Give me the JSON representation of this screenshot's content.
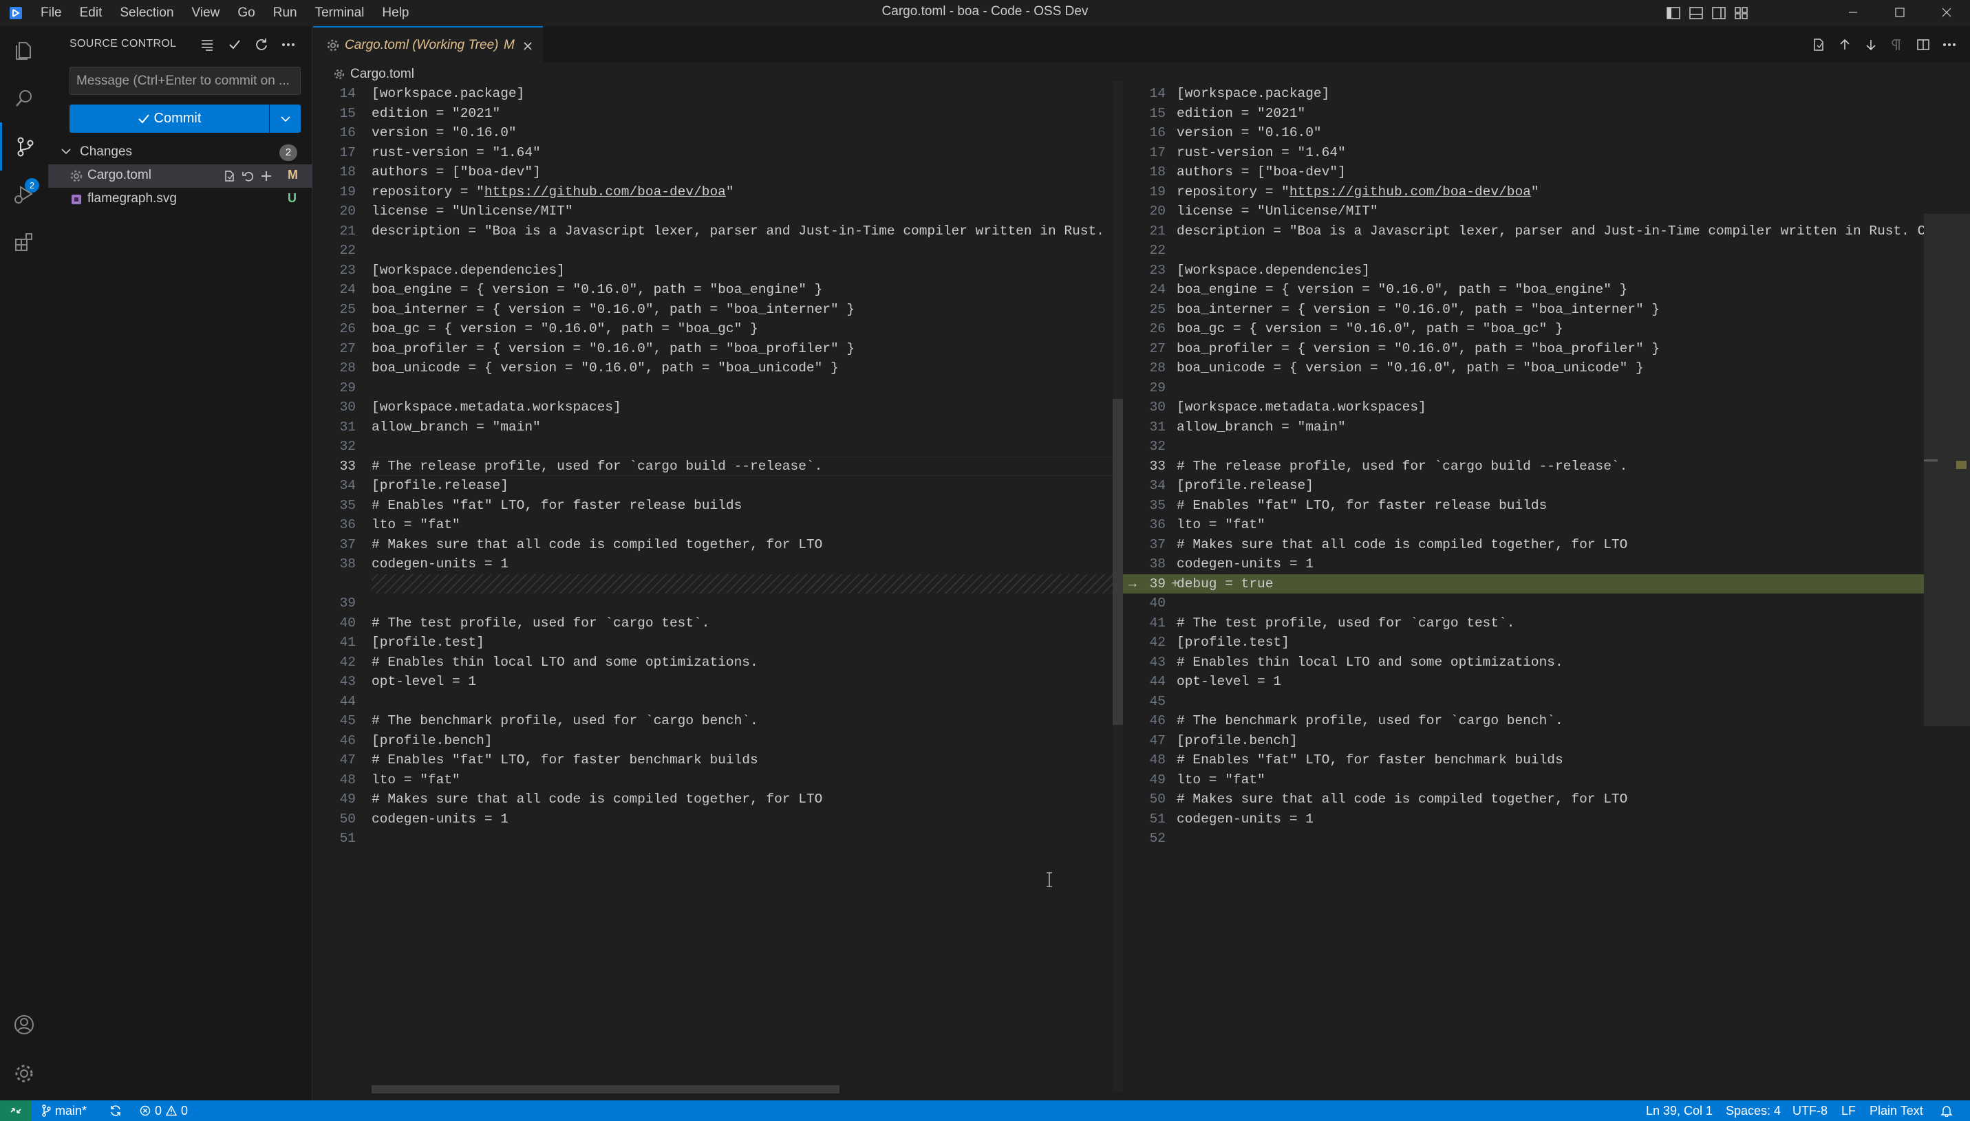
{
  "window": {
    "title": "Cargo.toml - boa - Code - OSS Dev"
  },
  "menu": [
    "File",
    "Edit",
    "Selection",
    "View",
    "Go",
    "Run",
    "Terminal",
    "Help"
  ],
  "activity_bar": {
    "scm_badge": "2"
  },
  "source_control": {
    "title": "SOURCE CONTROL",
    "commit_placeholder": "Message (Ctrl+Enter to commit on ...",
    "commit_label": "Commit",
    "changes_label": "Changes",
    "changes_count": "2",
    "files": [
      {
        "name": "Cargo.toml",
        "status": "M",
        "status_color": "#e2c08d"
      },
      {
        "name": "flamegraph.svg",
        "status": "U",
        "status_color": "#73c991"
      }
    ]
  },
  "tab": {
    "title": "Cargo.toml (Working Tree)",
    "modified": "M"
  },
  "breadcrumb": {
    "file": "Cargo.toml"
  },
  "diff": {
    "left": [
      {
        "n": "14",
        "t": "[workspace.package]"
      },
      {
        "n": "15",
        "t": "edition = \"2021\""
      },
      {
        "n": "16",
        "t": "version = \"0.16.0\""
      },
      {
        "n": "17",
        "t": "rust-version = \"1.64\""
      },
      {
        "n": "18",
        "t": "authors = [\"boa-dev\"]"
      },
      {
        "n": "19",
        "t": "repository = \"https://github.com/boa-dev/boa\""
      },
      {
        "n": "20",
        "t": "license = \"Unlicense/MIT\""
      },
      {
        "n": "21",
        "t": "description = \"Boa is a Javascript lexer, parser and Just-in-Time compiler written in Rust. Cur"
      },
      {
        "n": "22",
        "t": ""
      },
      {
        "n": "23",
        "t": "[workspace.dependencies]"
      },
      {
        "n": "24",
        "t": "boa_engine = { version = \"0.16.0\", path = \"boa_engine\" }"
      },
      {
        "n": "25",
        "t": "boa_interner = { version = \"0.16.0\", path = \"boa_interner\" }"
      },
      {
        "n": "26",
        "t": "boa_gc = { version = \"0.16.0\", path = \"boa_gc\" }"
      },
      {
        "n": "27",
        "t": "boa_profiler = { version = \"0.16.0\", path = \"boa_profiler\" }"
      },
      {
        "n": "28",
        "t": "boa_unicode = { version = \"0.16.0\", path = \"boa_unicode\" }"
      },
      {
        "n": "29",
        "t": ""
      },
      {
        "n": "30",
        "t": "[workspace.metadata.workspaces]"
      },
      {
        "n": "31",
        "t": "allow_branch = \"main\""
      },
      {
        "n": "32",
        "t": ""
      },
      {
        "n": "33",
        "t": "# The release profile, used for `cargo build --release`."
      },
      {
        "n": "34",
        "t": "[profile.release]"
      },
      {
        "n": "35",
        "t": "# Enables \"fat\" LTO, for faster release builds"
      },
      {
        "n": "36",
        "t": "lto = \"fat\""
      },
      {
        "n": "37",
        "t": "# Makes sure that all code is compiled together, for LTO"
      },
      {
        "n": "38",
        "t": "codegen-units = 1"
      },
      {
        "n": "",
        "t": ""
      },
      {
        "n": "39",
        "t": ""
      },
      {
        "n": "40",
        "t": "# The test profile, used for `cargo test`."
      },
      {
        "n": "41",
        "t": "[profile.test]"
      },
      {
        "n": "42",
        "t": "# Enables thin local LTO and some optimizations."
      },
      {
        "n": "43",
        "t": "opt-level = 1"
      },
      {
        "n": "44",
        "t": ""
      },
      {
        "n": "45",
        "t": "# The benchmark profile, used for `cargo bench`."
      },
      {
        "n": "46",
        "t": "[profile.bench]"
      },
      {
        "n": "47",
        "t": "# Enables \"fat\" LTO, for faster benchmark builds"
      },
      {
        "n": "48",
        "t": "lto = \"fat\""
      },
      {
        "n": "49",
        "t": "# Makes sure that all code is compiled together, for LTO"
      },
      {
        "n": "50",
        "t": "codegen-units = 1"
      },
      {
        "n": "51",
        "t": ""
      }
    ],
    "right": [
      {
        "n": "14",
        "t": "[workspace.package]"
      },
      {
        "n": "15",
        "t": "edition = \"2021\""
      },
      {
        "n": "16",
        "t": "version = \"0.16.0\""
      },
      {
        "n": "17",
        "t": "rust-version = \"1.64\""
      },
      {
        "n": "18",
        "t": "authors = [\"boa-dev\"]"
      },
      {
        "n": "19",
        "t": "repository = \"https://github.com/boa-dev/boa\""
      },
      {
        "n": "20",
        "t": "license = \"Unlicense/MIT\""
      },
      {
        "n": "21",
        "t": "description = \"Boa is a Javascript lexer, parser and Just-in-Time compiler written in Rust. Cur"
      },
      {
        "n": "22",
        "t": ""
      },
      {
        "n": "23",
        "t": "[workspace.dependencies]"
      },
      {
        "n": "24",
        "t": "boa_engine = { version = \"0.16.0\", path = \"boa_engine\" }"
      },
      {
        "n": "25",
        "t": "boa_interner = { version = \"0.16.0\", path = \"boa_interner\" }"
      },
      {
        "n": "26",
        "t": "boa_gc = { version = \"0.16.0\", path = \"boa_gc\" }"
      },
      {
        "n": "27",
        "t": "boa_profiler = { version = \"0.16.0\", path = \"boa_profiler\" }"
      },
      {
        "n": "28",
        "t": "boa_unicode = { version = \"0.16.0\", path = \"boa_unicode\" }"
      },
      {
        "n": "29",
        "t": ""
      },
      {
        "n": "30",
        "t": "[workspace.metadata.workspaces]"
      },
      {
        "n": "31",
        "t": "allow_branch = \"main\""
      },
      {
        "n": "32",
        "t": ""
      },
      {
        "n": "33",
        "t": "# The release profile, used for `cargo build --release`."
      },
      {
        "n": "34",
        "t": "[profile.release]"
      },
      {
        "n": "35",
        "t": "# Enables \"fat\" LTO, for faster release builds"
      },
      {
        "n": "36",
        "t": "lto = \"fat\""
      },
      {
        "n": "37",
        "t": "# Makes sure that all code is compiled together, for LTO"
      },
      {
        "n": "38",
        "t": "codegen-units = 1"
      },
      {
        "n": "39",
        "t": "debug = true"
      },
      {
        "n": "40",
        "t": ""
      },
      {
        "n": "41",
        "t": "# The test profile, used for `cargo test`."
      },
      {
        "n": "42",
        "t": "[profile.test]"
      },
      {
        "n": "43",
        "t": "# Enables thin local LTO and some optimizations."
      },
      {
        "n": "44",
        "t": "opt-level = 1"
      },
      {
        "n": "45",
        "t": ""
      },
      {
        "n": "46",
        "t": "# The benchmark profile, used for `cargo bench`."
      },
      {
        "n": "47",
        "t": "[profile.bench]"
      },
      {
        "n": "48",
        "t": "# Enables \"fat\" LTO, for faster benchmark builds"
      },
      {
        "n": "49",
        "t": "lto = \"fat\""
      },
      {
        "n": "50",
        "t": "# Makes sure that all code is compiled together, for LTO"
      },
      {
        "n": "51",
        "t": "codegen-units = 1"
      },
      {
        "n": "52",
        "t": ""
      }
    ],
    "added_line": "39",
    "cursor_line": "33",
    "added_color": "#4b5632"
  },
  "statusbar": {
    "branch": "main*",
    "errors": "0",
    "warnings": "0",
    "position": "Ln 39, Col 1",
    "spaces": "Spaces: 4",
    "encoding": "UTF-8",
    "eol": "LF",
    "language": "Plain Text"
  },
  "colors": {
    "accent": "#0078d4",
    "modified": "#e2c08d",
    "untracked": "#73c991"
  }
}
